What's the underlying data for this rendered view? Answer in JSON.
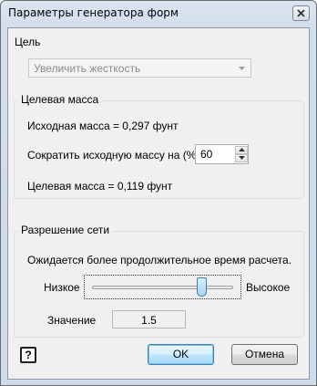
{
  "window": {
    "title": "Параметры генератора форм"
  },
  "goal": {
    "label": "Цель",
    "selected": "Увеличить жесткость"
  },
  "target_mass": {
    "group_title": "Целевая масса",
    "original_mass": "Исходная масса = 0,297 фунт",
    "reduce_label": "Сократить исходную массу на (%)",
    "reduce_value": "60",
    "target_mass": "Целевая масса = 0,119 фунт"
  },
  "mesh": {
    "group_title": "Разрешение сети",
    "note": "Ожидается более продолжительное время расчета.",
    "low_label": "Низкое",
    "high_label": "Высокое",
    "slider_fraction": 0.78,
    "value_label": "Значение",
    "value": "1.5"
  },
  "buttons": {
    "ok": "OK",
    "cancel": "Отмена"
  },
  "help": {
    "glyph": "?"
  }
}
